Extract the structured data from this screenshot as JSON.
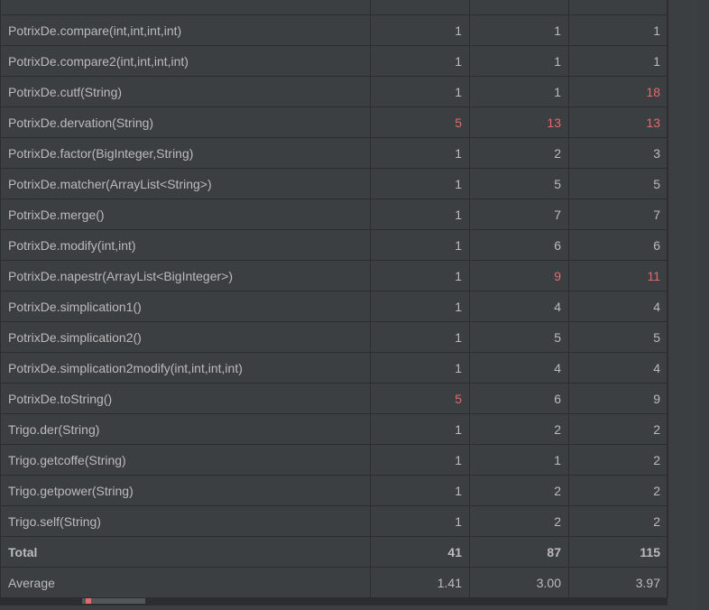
{
  "rows": [
    {
      "name": "PotrixDe.compare(int,int,int,int)",
      "c1": {
        "v": "1"
      },
      "c2": {
        "v": "1"
      },
      "c3": {
        "v": "1"
      }
    },
    {
      "name": "PotrixDe.compare2(int,int,int,int)",
      "c1": {
        "v": "1"
      },
      "c2": {
        "v": "1"
      },
      "c3": {
        "v": "1"
      }
    },
    {
      "name": "PotrixDe.cutf(String)",
      "c1": {
        "v": "1"
      },
      "c2": {
        "v": "1"
      },
      "c3": {
        "v": "18",
        "warn": true
      }
    },
    {
      "name": "PotrixDe.dervation(String)",
      "c1": {
        "v": "5",
        "warn": true
      },
      "c2": {
        "v": "13",
        "warn": true
      },
      "c3": {
        "v": "13",
        "warn": true
      }
    },
    {
      "name": "PotrixDe.factor(BigInteger,String)",
      "c1": {
        "v": "1"
      },
      "c2": {
        "v": "2"
      },
      "c3": {
        "v": "3"
      }
    },
    {
      "name": "PotrixDe.matcher(ArrayList<String>)",
      "c1": {
        "v": "1"
      },
      "c2": {
        "v": "5"
      },
      "c3": {
        "v": "5"
      }
    },
    {
      "name": "PotrixDe.merge()",
      "c1": {
        "v": "1"
      },
      "c2": {
        "v": "7"
      },
      "c3": {
        "v": "7"
      }
    },
    {
      "name": "PotrixDe.modify(int,int)",
      "c1": {
        "v": "1"
      },
      "c2": {
        "v": "6"
      },
      "c3": {
        "v": "6"
      }
    },
    {
      "name": "PotrixDe.napestr(ArrayList<BigInteger>)",
      "c1": {
        "v": "1"
      },
      "c2": {
        "v": "9",
        "warn": true
      },
      "c3": {
        "v": "11",
        "warn": true
      }
    },
    {
      "name": "PotrixDe.simplication1()",
      "c1": {
        "v": "1"
      },
      "c2": {
        "v": "4"
      },
      "c3": {
        "v": "4"
      }
    },
    {
      "name": "PotrixDe.simplication2()",
      "c1": {
        "v": "1"
      },
      "c2": {
        "v": "5"
      },
      "c3": {
        "v": "5"
      }
    },
    {
      "name": "PotrixDe.simplication2modify(int,int,int,int)",
      "c1": {
        "v": "1"
      },
      "c2": {
        "v": "4"
      },
      "c3": {
        "v": "4"
      }
    },
    {
      "name": "PotrixDe.toString()",
      "c1": {
        "v": "5",
        "warn": true
      },
      "c2": {
        "v": "6"
      },
      "c3": {
        "v": "9"
      }
    },
    {
      "name": "Trigo.der(String)",
      "c1": {
        "v": "1"
      },
      "c2": {
        "v": "2"
      },
      "c3": {
        "v": "2"
      }
    },
    {
      "name": "Trigo.getcoffe(String)",
      "c1": {
        "v": "1"
      },
      "c2": {
        "v": "1"
      },
      "c3": {
        "v": "2"
      }
    },
    {
      "name": "Trigo.getpower(String)",
      "c1": {
        "v": "1"
      },
      "c2": {
        "v": "2"
      },
      "c3": {
        "v": "2"
      }
    },
    {
      "name": "Trigo.self(String)",
      "c1": {
        "v": "1"
      },
      "c2": {
        "v": "2"
      },
      "c3": {
        "v": "2"
      }
    }
  ],
  "total": {
    "label": "Total",
    "c1": "41",
    "c2": "87",
    "c3": "115"
  },
  "average": {
    "label": "Average",
    "c1": "1.41",
    "c2": "3.00",
    "c3": "3.97"
  }
}
